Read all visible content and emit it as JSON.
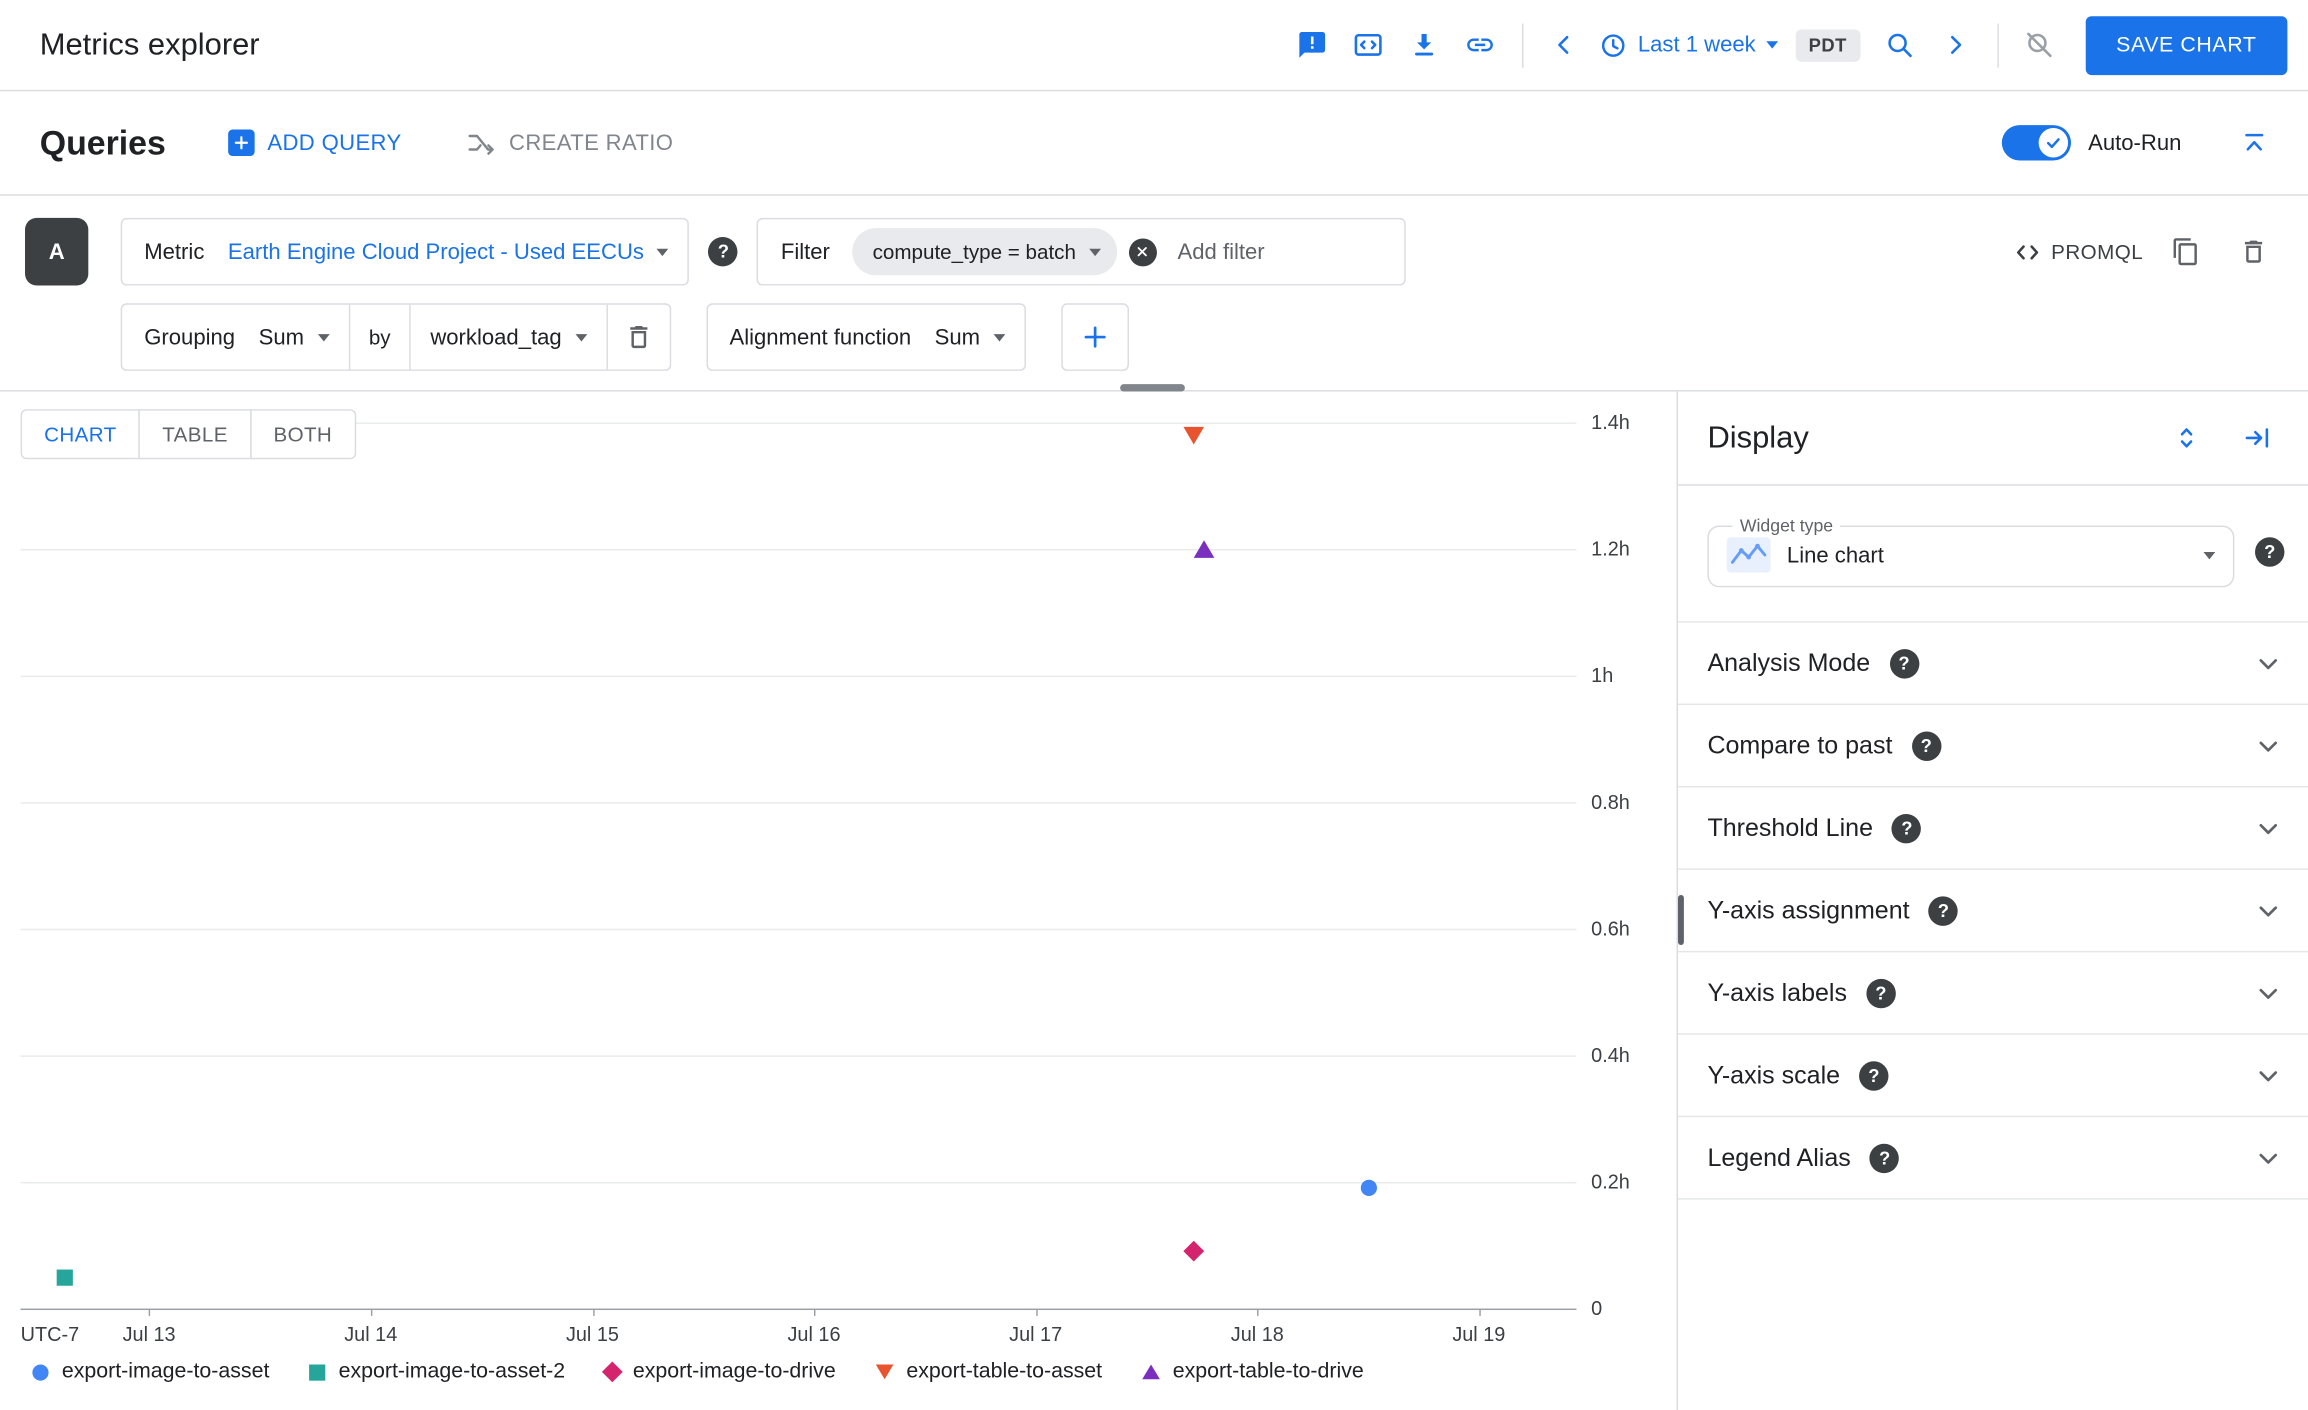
{
  "header": {
    "title": "Metrics explorer",
    "time_range": "Last 1 week",
    "timezone_badge": "PDT",
    "save_button": "SAVE CHART"
  },
  "queries_bar": {
    "title": "Queries",
    "add_query": "ADD QUERY",
    "create_ratio": "CREATE RATIO",
    "auto_run": "Auto-Run"
  },
  "query": {
    "badge": "A",
    "metric_label": "Metric",
    "metric_value": "Earth Engine Cloud Project - Used EECUs",
    "filter_label": "Filter",
    "filter_chip": "compute_type = batch",
    "add_filter_placeholder": "Add filter",
    "promql_label": "PROMQL",
    "grouping_label": "Grouping",
    "grouping_value": "Sum",
    "by_label": "by",
    "grouping_field": "workload_tag",
    "alignment_label": "Alignment function",
    "alignment_value": "Sum"
  },
  "view_tabs": [
    {
      "label": "CHART",
      "active": true
    },
    {
      "label": "TABLE",
      "active": false
    },
    {
      "label": "BOTH",
      "active": false
    }
  ],
  "chart_data": {
    "type": "scatter",
    "title": "",
    "x_axis_corner_label": "UTC-7",
    "xlim_days": [
      12.42,
      19.44
    ],
    "ylim_hours": [
      0,
      1.4
    ],
    "grid": "horizontal",
    "legend_position": "bottom",
    "x_ticks": [
      {
        "label": "Jul 13",
        "day": 13
      },
      {
        "label": "Jul 14",
        "day": 14
      },
      {
        "label": "Jul 15",
        "day": 15
      },
      {
        "label": "Jul 16",
        "day": 16
      },
      {
        "label": "Jul 17",
        "day": 17
      },
      {
        "label": "Jul 18",
        "day": 18
      },
      {
        "label": "Jul 19",
        "day": 19
      }
    ],
    "y_ticks": [
      {
        "label": "1.4h",
        "value": 1.4
      },
      {
        "label": "1.2h",
        "value": 1.2
      },
      {
        "label": "1h",
        "value": 1.0
      },
      {
        "label": "0.8h",
        "value": 0.8
      },
      {
        "label": "0.6h",
        "value": 0.6
      },
      {
        "label": "0.4h",
        "value": 0.4
      },
      {
        "label": "0.2h",
        "value": 0.2
      },
      {
        "label": "0",
        "value": 0
      }
    ],
    "series": [
      {
        "name": "export-image-to-asset",
        "marker": "circle",
        "color": "#4285f4",
        "points": [
          {
            "x_day": 18.5,
            "y_hours": 0.19
          }
        ]
      },
      {
        "name": "export-image-to-asset-2",
        "marker": "square",
        "color": "#26a69a",
        "points": [
          {
            "x_day": 12.62,
            "y_hours": 0.05
          }
        ]
      },
      {
        "name": "export-image-to-drive",
        "marker": "diamond",
        "color": "#d5246e",
        "points": [
          {
            "x_day": 17.71,
            "y_hours": 0.09
          }
        ]
      },
      {
        "name": "export-table-to-asset",
        "marker": "triangle-down",
        "color": "#e8542d",
        "points": [
          {
            "x_day": 17.71,
            "y_hours": 1.38
          }
        ]
      },
      {
        "name": "export-table-to-drive",
        "marker": "triangle-up",
        "color": "#7b2fbe",
        "points": [
          {
            "x_day": 17.76,
            "y_hours": 1.2
          }
        ]
      }
    ]
  },
  "display_panel": {
    "title": "Display",
    "widget_type_label": "Widget type",
    "widget_type_value": "Line chart",
    "sections": [
      "Analysis Mode",
      "Compare to past",
      "Threshold Line",
      "Y-axis assignment",
      "Y-axis labels",
      "Y-axis scale",
      "Legend Alias"
    ]
  }
}
